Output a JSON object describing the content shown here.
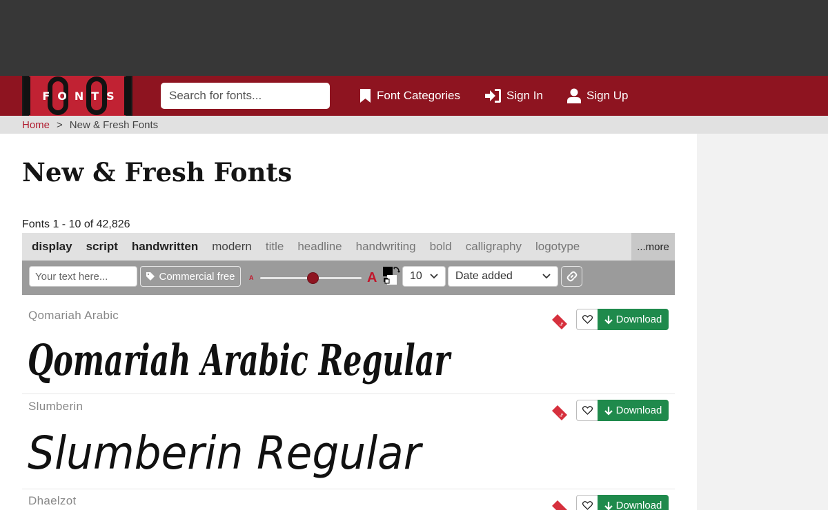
{
  "header": {
    "logo_text": "FONTS",
    "logo_digits": "1001",
    "search_placeholder": "Search for fonts...",
    "nav": [
      {
        "label": "Font Categories",
        "icon": "bookmark-icon"
      },
      {
        "label": "Sign In",
        "icon": "sign-in-icon"
      },
      {
        "label": "Sign Up",
        "icon": "user-icon"
      }
    ]
  },
  "breadcrumb": {
    "home": "Home",
    "separator": ">",
    "current": "New & Fresh Fonts"
  },
  "page": {
    "title": "New & Fresh Fonts",
    "count": "Fonts 1 - 10 of 42,826"
  },
  "tags": {
    "items": [
      "display",
      "script",
      "handwritten",
      "modern",
      "title",
      "headline",
      "handwriting",
      "bold",
      "calligraphy",
      "logotype"
    ],
    "more": "...more"
  },
  "toolbar": {
    "text_placeholder": "Your text here...",
    "commercial_label": "Commercial free",
    "small_a": "A",
    "big_a": "A",
    "size_percent": 52,
    "count_value": "10",
    "sort_value": "Date added"
  },
  "fonts": [
    {
      "name": "Qomariah Arabic",
      "sample": "Qomariah Arabic Regular",
      "download": "Download"
    },
    {
      "name": "Slumberin",
      "sample": "Slumberin Regular",
      "download": "Download"
    },
    {
      "name": "Dhaelzot",
      "sample": "",
      "download": "Download"
    }
  ],
  "colors": {
    "header": "#8e1420",
    "top": "#373737",
    "download": "#1f8a4c",
    "accent": "#c1162b"
  }
}
